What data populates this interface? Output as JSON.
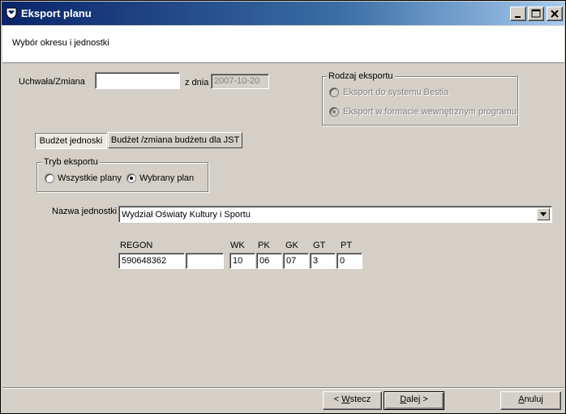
{
  "window": {
    "title": "Eksport planu",
    "icon": "app-shield-icon",
    "controls": [
      "minimize-icon",
      "maximize-icon",
      "close-icon"
    ]
  },
  "header": {
    "subtitle": "Wybór okresu i jednostki"
  },
  "form": {
    "uchwala_label": "Uchwała/Zmiana",
    "uchwala_value": "",
    "date_label": "z dnia",
    "date_value": "2007-10-20"
  },
  "export_type": {
    "title": "Rodzaj eksportu",
    "options": [
      {
        "label": "Eksport do systemu Bestia",
        "selected": false,
        "enabled": false
      },
      {
        "label": "Eksport w formacie wewnętrznym programu",
        "selected": true,
        "enabled": false
      }
    ]
  },
  "tabs": [
    {
      "label": "Budżet jednoski",
      "active": true
    },
    {
      "label": "Budżet /zmiana budżetu dla JST",
      "active": false
    }
  ],
  "export_mode": {
    "title": "Tryb eksportu",
    "options": [
      {
        "label": "Wszystkie plany",
        "selected": false
      },
      {
        "label": "Wybrany plan",
        "selected": true
      }
    ]
  },
  "unit": {
    "label": "Nazwa jednostki",
    "selected": "Wydział Oświaty Kultury i Sportu"
  },
  "codes": {
    "regon_label": "REGON",
    "regon_value": "590648362",
    "regon_suffix": "",
    "wk_label": "WK",
    "wk_value": "10",
    "pk_label": "PK",
    "pk_value": "06",
    "gk_label": "GK",
    "gk_value": "07",
    "gt_label": "GT",
    "gt_value": "3",
    "pt_label": "PT",
    "pt_value": "0"
  },
  "buttons": {
    "back_prefix": "< ",
    "back_mnemonic": "W",
    "back_rest": "stecz",
    "next_mnemonic": "D",
    "next_rest": "alej >",
    "cancel_mnemonic": "A",
    "cancel_rest": "nuluj"
  }
}
